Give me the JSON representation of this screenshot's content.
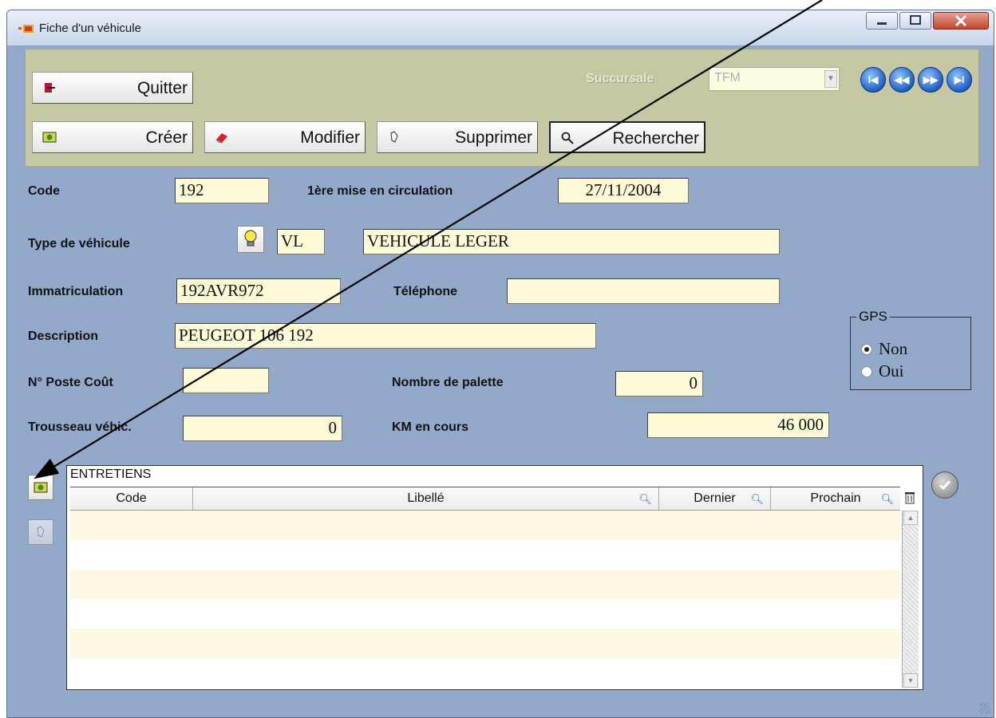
{
  "window": {
    "title": "Fiche d'un véhicule",
    "controls": {
      "minimize": "–",
      "maximize": "▢",
      "close": "X"
    }
  },
  "toolbar": {
    "quit_label": "Quitter",
    "create_label": "Créer",
    "modify_label": "Modifier",
    "delete_label": "Supprimer",
    "search_label": "Rechercher",
    "branch_label": "Succursale",
    "branch_value": "TFM",
    "nav": {
      "first": "I◀",
      "prev": "◀◀",
      "next": "▶▶",
      "last": "▶I"
    }
  },
  "form": {
    "code_label": "Code",
    "code_value": "192",
    "first_reg_label": "1ère mise en circulation",
    "first_reg_value": "27/11/2004",
    "vehicle_type_label": "Type de véhicule",
    "vehicle_type_code": "VL",
    "vehicle_type_name": "VEHICULE LEGER",
    "plate_label": "Immatriculation",
    "plate_value": "192AVR972",
    "phone_label": "Téléphone",
    "phone_value": "",
    "description_label": "Description",
    "description_value": "PEUGEOT 106 192",
    "cost_post_label": "N° Poste Coût",
    "cost_post_value": "",
    "pallets_label": "Nombre de palette",
    "pallets_value": "0",
    "keyring_label": "Trousseau véhic.",
    "keyring_value": "0",
    "km_label": "KM en cours",
    "km_value": "46 000",
    "gps": {
      "legend": "GPS",
      "options": [
        "Non",
        "Oui"
      ],
      "selected": "Non"
    }
  },
  "maintenance": {
    "title": "ENTRETIENS",
    "columns": [
      "Code",
      "Libellé",
      "Dernier",
      "Prochain"
    ],
    "rows": []
  },
  "icons": {
    "bulb": "lightbulb-icon",
    "check": "check-icon",
    "trash": "trash-icon",
    "search": "magnifier-icon"
  },
  "colors": {
    "window_bg": "#93a9c9",
    "toolbar_bg": "#c6c8a4",
    "field_bg": "#fdfad8",
    "row_alt": "#fdf9e2"
  }
}
